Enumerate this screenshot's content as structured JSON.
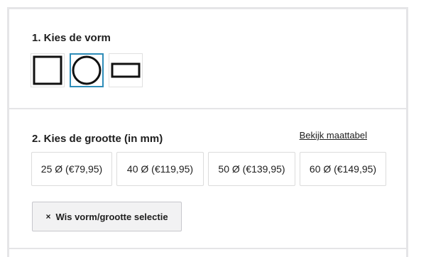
{
  "shape_section": {
    "heading": "1. Kies de vorm",
    "shapes": [
      {
        "name": "square",
        "icon": "square-shape-icon",
        "selected": false
      },
      {
        "name": "circle",
        "icon": "circle-shape-icon",
        "selected": true
      },
      {
        "name": "rectangle",
        "icon": "rectangle-shape-icon",
        "selected": false
      }
    ]
  },
  "size_section": {
    "heading": "2. Kies de grootte (in mm)",
    "size_table_link": "Bekijk maattabel",
    "sizes": [
      {
        "label": "25 Ø (€79,95)"
      },
      {
        "label": "40 Ø (€119,95)"
      },
      {
        "label": "50 Ø (€139,95)"
      },
      {
        "label": "60 Ø (€149,95)"
      }
    ],
    "clear_button": {
      "icon": "×",
      "label": "Wis vorm/grootte selectie"
    }
  },
  "colors": {
    "selected_border": "#2e8cb8",
    "divider": "#e5e5e7",
    "text": "#1e1e1e"
  }
}
